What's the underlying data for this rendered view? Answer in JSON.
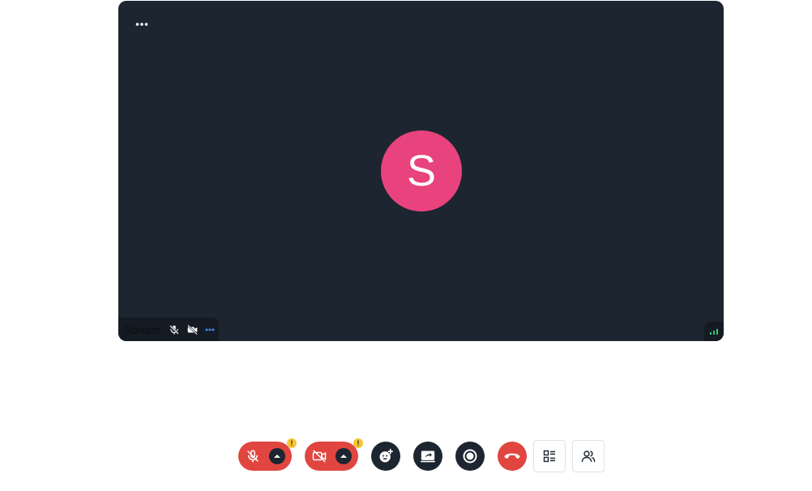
{
  "tile": {
    "participant_initial": "S",
    "participant_name": "Sonam",
    "avatar_color": "#e8437d",
    "background_color": "#1c2530",
    "more_icon": "more-horizontal-icon",
    "status_icons": [
      "mic-off-icon",
      "camera-off-icon",
      "more-horizontal-icon"
    ],
    "connection_icon": "signal-bars-icon"
  },
  "toolbar": {
    "mic": {
      "icon": "mic-off-icon",
      "state": "muted",
      "warning": "!"
    },
    "camera": {
      "icon": "camera-off-icon",
      "state": "off",
      "warning": "!"
    },
    "reactions": {
      "icon": "emoji-add-icon"
    },
    "share_screen": {
      "icon": "screen-share-icon"
    },
    "record": {
      "icon": "record-icon"
    },
    "leave": {
      "icon": "phone-hangup-icon"
    },
    "layout": {
      "icon": "grid-list-icon"
    },
    "participants": {
      "icon": "people-icon"
    },
    "colors": {
      "danger": "#e0463f",
      "dark": "#1c2530",
      "warning": "#f7c531"
    }
  }
}
